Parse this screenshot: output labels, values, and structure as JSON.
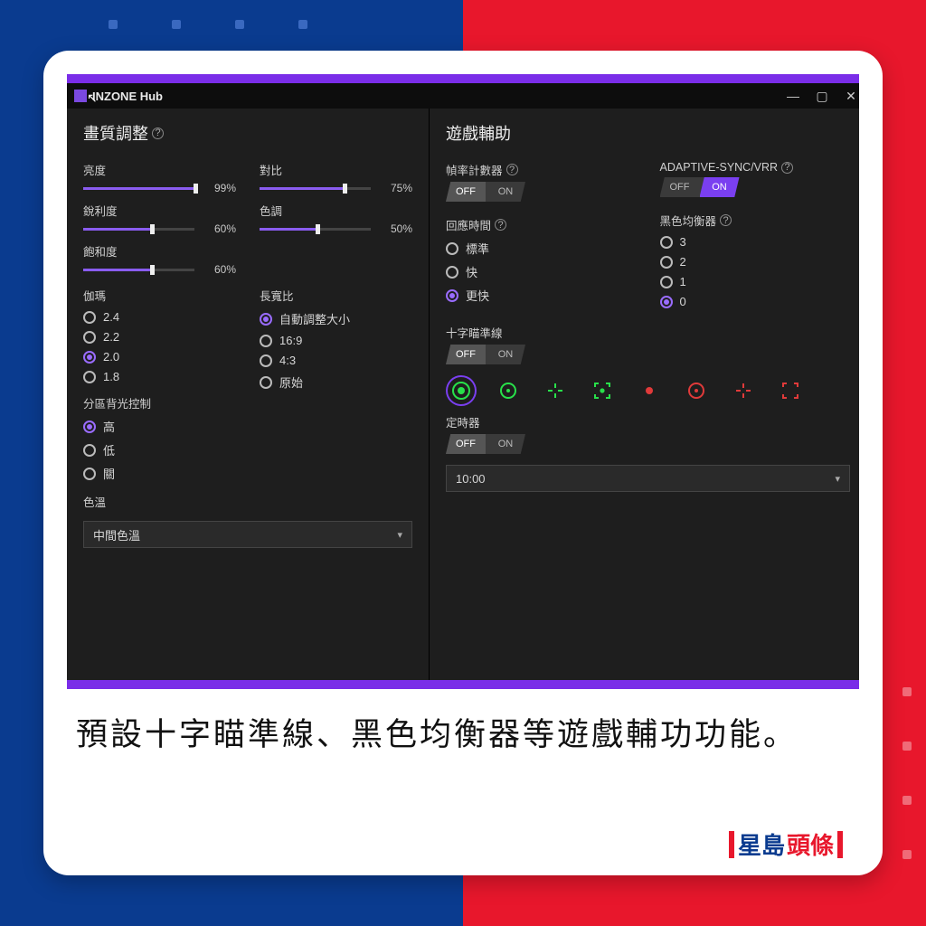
{
  "frame": {
    "caption": "預設十字瞄準線、黑色均衡器等遊戲輔功功能。",
    "brand_a": "星島",
    "brand_b": "頭條"
  },
  "app": {
    "title": "INZONE Hub",
    "left": {
      "section": "畫質調整",
      "sliders": {
        "brightness": {
          "label": "亮度",
          "value": "99%",
          "pct": 99
        },
        "contrast": {
          "label": "對比",
          "value": "75%",
          "pct": 75
        },
        "sharpness": {
          "label": "銳利度",
          "value": "60%",
          "pct": 60
        },
        "hue": {
          "label": "色調",
          "value": "50%",
          "pct": 50
        },
        "saturation": {
          "label": "飽和度",
          "value": "60%",
          "pct": 60
        }
      },
      "gamma": {
        "label": "伽瑪",
        "options": [
          "2.4",
          "2.2",
          "2.0",
          "1.8"
        ],
        "selected": "2.0"
      },
      "aspect": {
        "label": "長寬比",
        "options": [
          "自動調整大小",
          "16:9",
          "4:3",
          "原始"
        ],
        "selected": "自動調整大小"
      },
      "local_dimming": {
        "label": "分區背光控制",
        "options": [
          "高",
          "低",
          "關"
        ],
        "selected": "高"
      },
      "color_temp": {
        "label": "色溫",
        "value": "中間色溫"
      }
    },
    "right": {
      "section": "遊戲輔助",
      "fps": {
        "label": "幀率計數器",
        "off": "OFF",
        "on": "ON",
        "value": "OFF"
      },
      "async": {
        "label": "ADAPTIVE-SYNC/VRR",
        "off": "OFF",
        "on": "ON",
        "value": "ON"
      },
      "response": {
        "label": "回應時間",
        "options": [
          "標準",
          "快",
          "更快"
        ],
        "selected": "更快"
      },
      "black_eq": {
        "label": "黑色均衡器",
        "options": [
          "3",
          "2",
          "1",
          "0"
        ],
        "selected": "0"
      },
      "crosshair": {
        "label": "十字瞄準線",
        "off": "OFF",
        "on": "ON",
        "value": "OFF"
      },
      "timer": {
        "label": "定時器",
        "off": "OFF",
        "on": "ON",
        "value": "OFF",
        "preset": "10:00"
      }
    }
  }
}
